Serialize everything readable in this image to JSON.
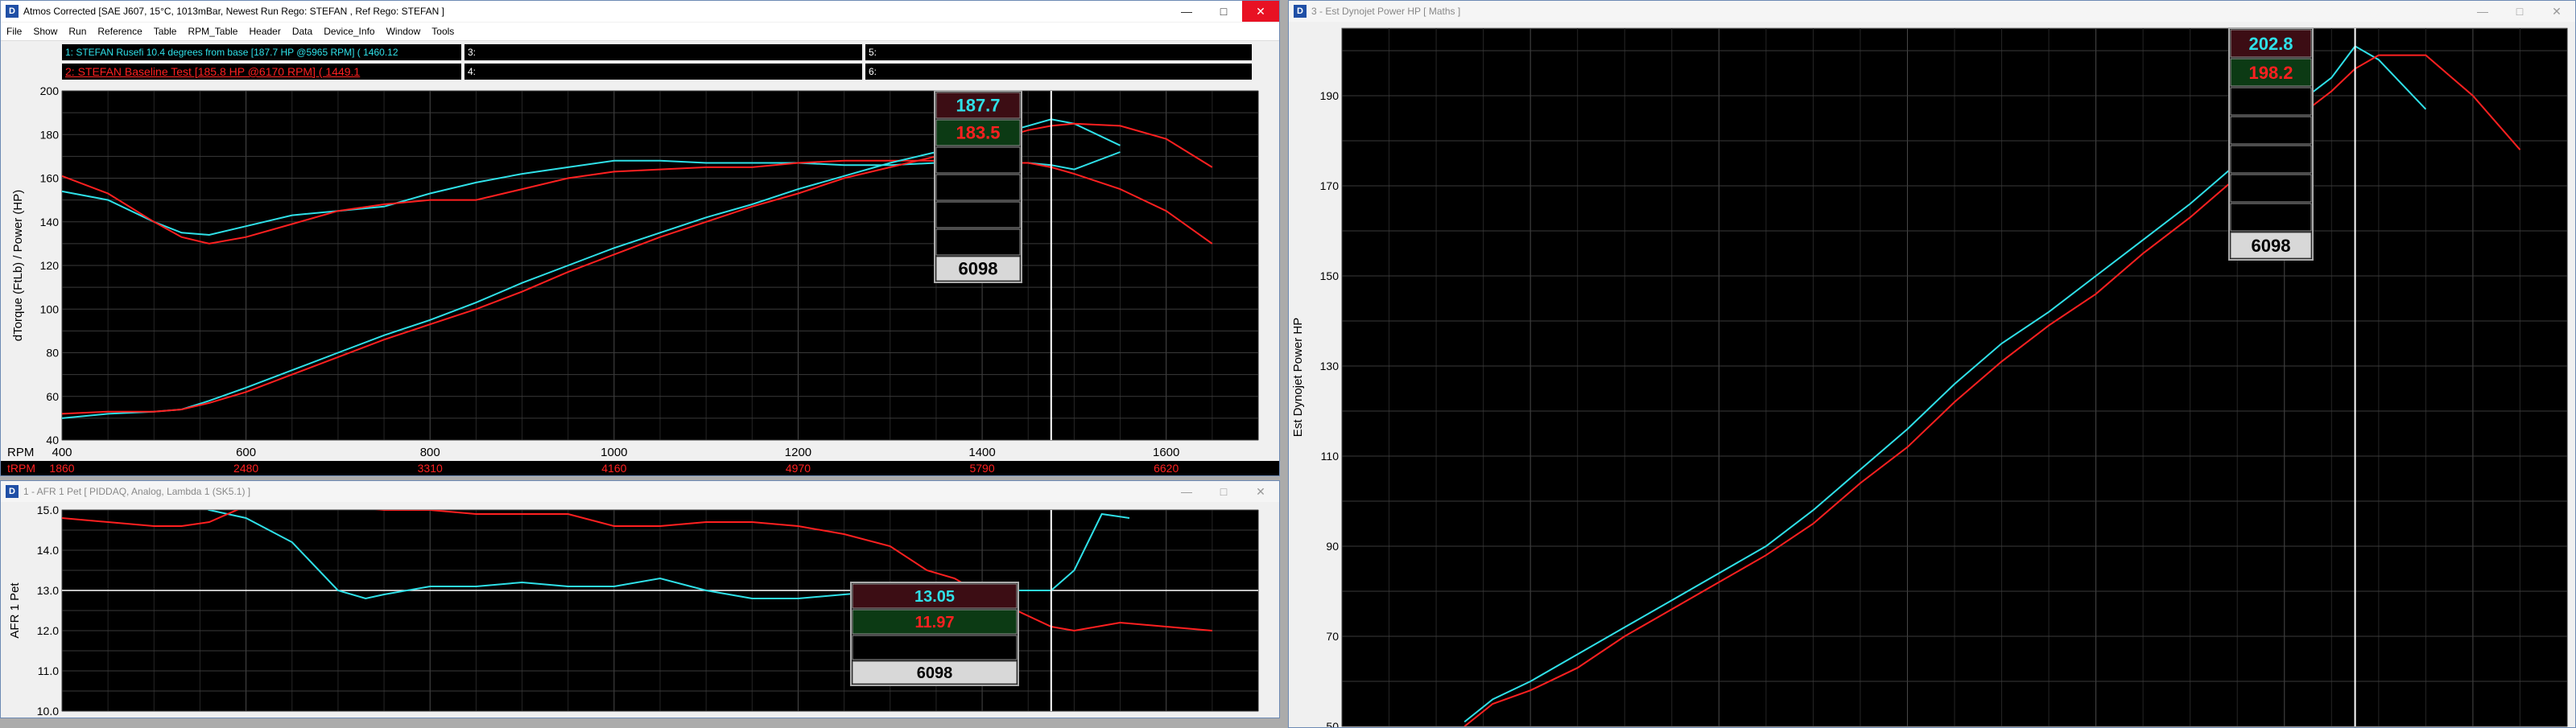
{
  "windows": {
    "main": {
      "title": "Atmos Corrected [SAE J607, 15°C, 1013mBar,  Newest Run Rego: STEFAN ,  Ref Rego: STEFAN ]",
      "menu": [
        "File",
        "Show",
        "Run",
        "Reference",
        "Table",
        "RPM_Table",
        "Header",
        "Data",
        "Device_Info",
        "Window",
        "Tools"
      ],
      "legend": {
        "l1": "1:   STEFAN Rusefi 10.4 degrees from base [187.7 HP @5965 RPM] ( 1460.12",
        "l2": "2:   STEFAN Baseline Test [185.8 HP @6170 RPM] ( 1449.1",
        "l3": "3:",
        "l4": "4:",
        "l5": "5:",
        "l6": "6:"
      },
      "ylabel": "dTorque (FtLb) / Power (HP)",
      "xlabel": "RPM",
      "trpm_label": "tRPM",
      "cursor_readout": {
        "v1": "187.7",
        "v2": "183.5",
        "rpm": "6098"
      }
    },
    "afr": {
      "title": "1 - AFR 1 Pet     [ PIDDAQ, Analog, Lambda 1 (SK5.1) ]",
      "ylabel": "AFR 1 Pet",
      "cursor_readout": {
        "v1": "13.05",
        "v2": "11.97",
        "rpm": "6098"
      }
    },
    "power": {
      "title": "3 - Est Dynojet Power HP     [ Maths ]",
      "ylabel": "Est Dynojet Power HP",
      "cursor_readout": {
        "v1": "202.8",
        "v2": "198.2",
        "rpm": "6098"
      }
    }
  },
  "window_buttons": {
    "minimize": "—",
    "maximize": "□",
    "close": "✕"
  },
  "colors": {
    "run1": "#2fe0e8",
    "run2": "#ff2020",
    "cursor": "#ffffff",
    "grid": "#3a3a3a",
    "bg": "#000000",
    "titlebar": "#ffffff"
  },
  "chart_data": [
    {
      "type": "line",
      "title": "",
      "xlabel": "RPM",
      "ylabel": "dTorque (FtLb) / Power (HP)",
      "xlim": [
        400,
        1700
      ],
      "ylim": [
        40,
        200
      ],
      "xticks": [
        "400",
        "600",
        "800",
        "1000",
        "1200",
        "1400",
        "1600"
      ],
      "yticks": [
        "40",
        "60",
        "80",
        "100",
        "120",
        "140",
        "160",
        "180",
        "200"
      ],
      "trpm_ticks": [
        "1860",
        "2480",
        "3310",
        "4160",
        "4970",
        "5790",
        "6620"
      ],
      "cursor_x": 1475,
      "series": [
        {
          "name": "1",
          "color": "#2fe0e8",
          "x": [
            400,
            450,
            500,
            530,
            560,
            600,
            650,
            700,
            750,
            800,
            850,
            900,
            950,
            1000,
            1050,
            1100,
            1150,
            1200,
            1250,
            1300,
            1350,
            1400,
            1450,
            1475,
            1500,
            1550
          ],
          "y": [
            154,
            150,
            140,
            135,
            134,
            138,
            143,
            145,
            147,
            153,
            158,
            162,
            165,
            168,
            168,
            167,
            167,
            167,
            166,
            166,
            167,
            167,
            167,
            166,
            164,
            172
          ]
        },
        {
          "name": "2",
          "color": "#ff2020",
          "x": [
            400,
            450,
            500,
            530,
            560,
            600,
            650,
            700,
            750,
            800,
            850,
            900,
            950,
            1000,
            1050,
            1100,
            1150,
            1200,
            1250,
            1300,
            1350,
            1400,
            1450,
            1475,
            1500,
            1550,
            1600,
            1650
          ],
          "y": [
            161,
            153,
            140,
            133,
            130,
            133,
            139,
            145,
            148,
            150,
            150,
            155,
            160,
            163,
            164,
            165,
            165,
            167,
            168,
            168,
            168,
            167,
            167,
            165,
            162,
            155,
            145,
            130
          ]
        },
        {
          "name": "1",
          "color": "#2fe0e8",
          "x": [
            400,
            450,
            500,
            530,
            560,
            600,
            650,
            700,
            750,
            800,
            850,
            900,
            950,
            1000,
            1050,
            1100,
            1150,
            1200,
            1250,
            1300,
            1350,
            1400,
            1450,
            1475,
            1500,
            1550
          ],
          "y": [
            50,
            52,
            53,
            54,
            58,
            64,
            72,
            80,
            88,
            95,
            103,
            112,
            120,
            128,
            135,
            142,
            148,
            155,
            161,
            167,
            172,
            178,
            184,
            187,
            185,
            175
          ]
        },
        {
          "name": "2",
          "color": "#ff2020",
          "x": [
            400,
            450,
            500,
            530,
            560,
            600,
            650,
            700,
            750,
            800,
            850,
            900,
            950,
            1000,
            1050,
            1100,
            1150,
            1200,
            1250,
            1300,
            1350,
            1400,
            1450,
            1475,
            1500,
            1550,
            1600,
            1650
          ],
          "y": [
            52,
            53,
            53,
            54,
            57,
            62,
            70,
            78,
            86,
            93,
            100,
            108,
            117,
            125,
            133,
            140,
            147,
            153,
            160,
            165,
            170,
            176,
            182,
            184,
            185,
            184,
            178,
            165
          ]
        }
      ]
    },
    {
      "type": "line",
      "title": "",
      "ylabel": "AFR 1 Pet",
      "xlim": [
        400,
        1700
      ],
      "ylim": [
        10.0,
        15.0
      ],
      "yticks": [
        "10.0",
        "11.0",
        "12.0",
        "13.0",
        "14.0",
        "15.0"
      ],
      "ref_line": 13.0,
      "cursor_x": 1475,
      "series": [
        {
          "name": "1",
          "color": "#2fe0e8",
          "x": [
            400,
            530,
            560,
            600,
            650,
            700,
            730,
            750,
            800,
            850,
            900,
            950,
            1000,
            1050,
            1100,
            1150,
            1200,
            1250,
            1300,
            1340,
            1370,
            1400,
            1430,
            1460,
            1475,
            1500,
            1530,
            1560
          ],
          "y": [
            15.5,
            15.3,
            15.0,
            14.8,
            14.2,
            13.0,
            12.8,
            12.9,
            13.1,
            13.1,
            13.2,
            13.1,
            13.1,
            13.3,
            13.0,
            12.8,
            12.8,
            12.9,
            13.0,
            13.0,
            13.0,
            13.0,
            13.0,
            13.0,
            13.0,
            13.5,
            14.9,
            14.8
          ]
        },
        {
          "name": "2",
          "color": "#ff2020",
          "x": [
            400,
            450,
            500,
            530,
            560,
            600,
            650,
            700,
            750,
            800,
            850,
            900,
            950,
            1000,
            1050,
            1100,
            1150,
            1200,
            1250,
            1300,
            1340,
            1370,
            1400,
            1475,
            1500,
            1550,
            1600,
            1650
          ],
          "y": [
            14.8,
            14.7,
            14.6,
            14.6,
            14.7,
            15.1,
            15.2,
            15.1,
            15.0,
            15.0,
            14.9,
            14.9,
            14.9,
            14.6,
            14.6,
            14.7,
            14.7,
            14.6,
            14.4,
            14.1,
            13.5,
            13.3,
            12.9,
            12.1,
            12.0,
            12.2,
            12.1,
            12.0
          ]
        }
      ]
    },
    {
      "type": "line",
      "title": "",
      "ylabel": "Est Dynojet Power HP",
      "xlim": [
        400,
        1700
      ],
      "ylim": [
        50,
        205
      ],
      "yticks": [
        "50",
        "70",
        "90",
        "110",
        "130",
        "150",
        "170",
        "190"
      ],
      "cursor_x": 1475,
      "series": [
        {
          "name": "1",
          "color": "#2fe0e8",
          "x": [
            530,
            560,
            600,
            650,
            700,
            750,
            800,
            850,
            900,
            950,
            1000,
            1050,
            1100,
            1150,
            1200,
            1250,
            1300,
            1350,
            1400,
            1450,
            1475,
            1500,
            1550
          ],
          "y": [
            51,
            56,
            60,
            66,
            72,
            78,
            84,
            90,
            98,
            107,
            116,
            126,
            135,
            142,
            150,
            158,
            166,
            175,
            186,
            194,
            201,
            198,
            187
          ]
        },
        {
          "name": "2",
          "color": "#ff2020",
          "x": [
            530,
            560,
            600,
            650,
            700,
            750,
            800,
            850,
            900,
            950,
            1000,
            1050,
            1100,
            1150,
            1200,
            1250,
            1300,
            1350,
            1400,
            1450,
            1475,
            1500,
            1550,
            1600,
            1650
          ],
          "y": [
            50,
            55,
            58,
            63,
            70,
            76,
            82,
            88,
            95,
            104,
            112,
            122,
            131,
            139,
            146,
            155,
            163,
            172,
            183,
            191,
            196,
            199,
            199,
            190,
            178
          ]
        }
      ]
    }
  ]
}
